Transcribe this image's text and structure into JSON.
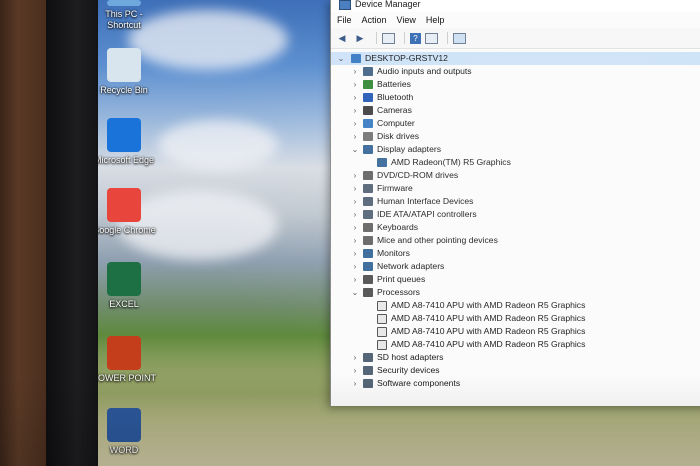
{
  "desktop": {
    "icons": [
      {
        "label": "This PC - Shortcut",
        "icon": "this-pc-icon",
        "color": "#6fa8dc"
      },
      {
        "label": "Recycle Bin",
        "icon": "recycle-bin-icon",
        "color": "#d8e4ee"
      },
      {
        "label": "Microsoft Edge",
        "icon": "edge-icon",
        "color": "#1a73d8"
      },
      {
        "label": "Google Chrome",
        "icon": "chrome-icon",
        "color": "#e8453c"
      },
      {
        "label": "EXCEL",
        "icon": "excel-icon",
        "color": "#1d7044"
      },
      {
        "label": "POWER POINT",
        "icon": "powerpoint-icon",
        "color": "#c43e1c"
      },
      {
        "label": "WORD",
        "icon": "word-icon",
        "color": "#2b579a"
      }
    ]
  },
  "window": {
    "title": "Device Manager",
    "menu": [
      "File",
      "Action",
      "View",
      "Help"
    ],
    "toolbar": [
      "back-arrow-icon",
      "forward-arrow-icon",
      "properties-icon",
      "help-icon",
      "update-driver-icon",
      "monitor-icon"
    ]
  },
  "tree": {
    "root": "DESKTOP-GRSTV12",
    "items": [
      {
        "label": "Audio inputs and outputs",
        "icon": "speaker-icon",
        "color": "#4a6a8a",
        "expanded": false
      },
      {
        "label": "Batteries",
        "icon": "battery-icon",
        "color": "#3a8a3a",
        "expanded": false
      },
      {
        "label": "Bluetooth",
        "icon": "bluetooth-icon",
        "color": "#2a5fb8",
        "expanded": false
      },
      {
        "label": "Cameras",
        "icon": "camera-icon",
        "color": "#444444",
        "expanded": false
      },
      {
        "label": "Computer",
        "icon": "computer-icon",
        "color": "#3f7fc4",
        "expanded": false
      },
      {
        "label": "Disk drives",
        "icon": "disk-drive-icon",
        "color": "#777777",
        "expanded": false
      },
      {
        "label": "Display adapters",
        "icon": "display-adapter-icon",
        "color": "#3a6a9a",
        "expanded": true,
        "children": [
          {
            "label": "AMD Radeon(TM) R5 Graphics",
            "icon": "display-adapter-icon"
          }
        ]
      },
      {
        "label": "DVD/CD-ROM drives",
        "icon": "dvd-icon",
        "color": "#666666",
        "expanded": false
      },
      {
        "label": "Firmware",
        "icon": "firmware-icon",
        "color": "#556677",
        "expanded": false
      },
      {
        "label": "Human Interface Devices",
        "icon": "hid-icon",
        "color": "#556677",
        "expanded": false
      },
      {
        "label": "IDE ATA/ATAPI controllers",
        "icon": "ide-controller-icon",
        "color": "#556677",
        "expanded": false
      },
      {
        "label": "Keyboards",
        "icon": "keyboard-icon",
        "color": "#666666",
        "expanded": false
      },
      {
        "label": "Mice and other pointing devices",
        "icon": "mouse-icon",
        "color": "#666666",
        "expanded": false
      },
      {
        "label": "Monitors",
        "icon": "monitor-icon",
        "color": "#3a6a9a",
        "expanded": false
      },
      {
        "label": "Network adapters",
        "icon": "network-adapter-icon",
        "color": "#3a6a9a",
        "expanded": false
      },
      {
        "label": "Print queues",
        "icon": "printer-icon",
        "color": "#555555",
        "expanded": false
      },
      {
        "label": "Processors",
        "icon": "processor-icon",
        "color": "#555555",
        "expanded": true,
        "children": [
          {
            "label": "AMD A8-7410 APU with AMD Radeon R5 Graphics",
            "icon": "processor-icon"
          },
          {
            "label": "AMD A8-7410 APU with AMD Radeon R5 Graphics",
            "icon": "processor-icon"
          },
          {
            "label": "AMD A8-7410 APU with AMD Radeon R5 Graphics",
            "icon": "processor-icon"
          },
          {
            "label": "AMD A8-7410 APU with AMD Radeon R5 Graphics",
            "icon": "processor-icon"
          }
        ]
      },
      {
        "label": "SD host adapters",
        "icon": "sd-adapter-icon",
        "color": "#556677",
        "expanded": false
      },
      {
        "label": "Security devices",
        "icon": "security-device-icon",
        "color": "#556677",
        "expanded": false
      },
      {
        "label": "Software components",
        "icon": "software-component-icon",
        "color": "#556677",
        "expanded": false
      }
    ]
  }
}
